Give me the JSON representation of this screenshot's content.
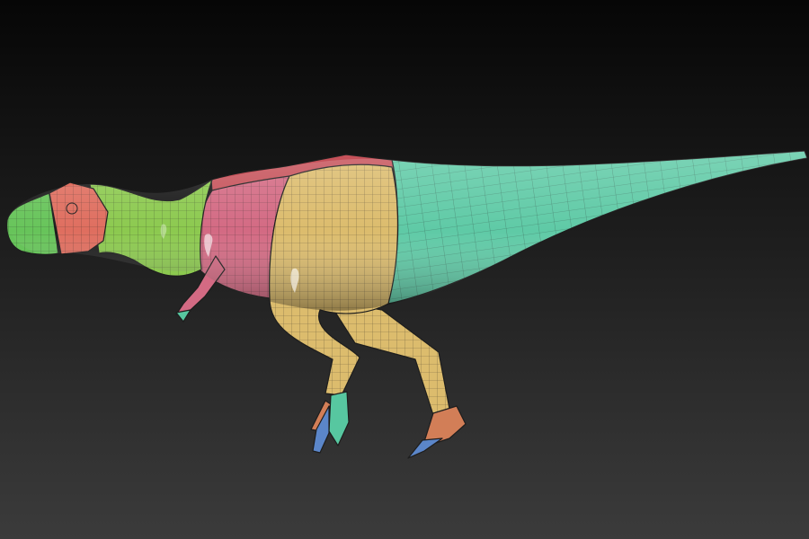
{
  "viewport": {
    "background_top": "#060606",
    "background_bottom": "#3b3b3b"
  },
  "model": {
    "name_hidden": "",
    "polygroups": [
      {
        "id": "snout",
        "color": "#67c45a"
      },
      {
        "id": "jaw-cap",
        "color": "#df6e5f"
      },
      {
        "id": "neck",
        "color": "#8cc94f"
      },
      {
        "id": "chest",
        "color": "#d36a83"
      },
      {
        "id": "back-stripe",
        "color": "#c6525a"
      },
      {
        "id": "thigh",
        "color": "#dcbc6d"
      },
      {
        "id": "tail",
        "color": "#5fcaa6"
      },
      {
        "id": "toe-blue",
        "color": "#5b86c9"
      },
      {
        "id": "toe-orange",
        "color": "#d27e57"
      },
      {
        "id": "toe-teal",
        "color": "#57c7a0"
      }
    ],
    "wire_color": "#1d1d1d"
  }
}
